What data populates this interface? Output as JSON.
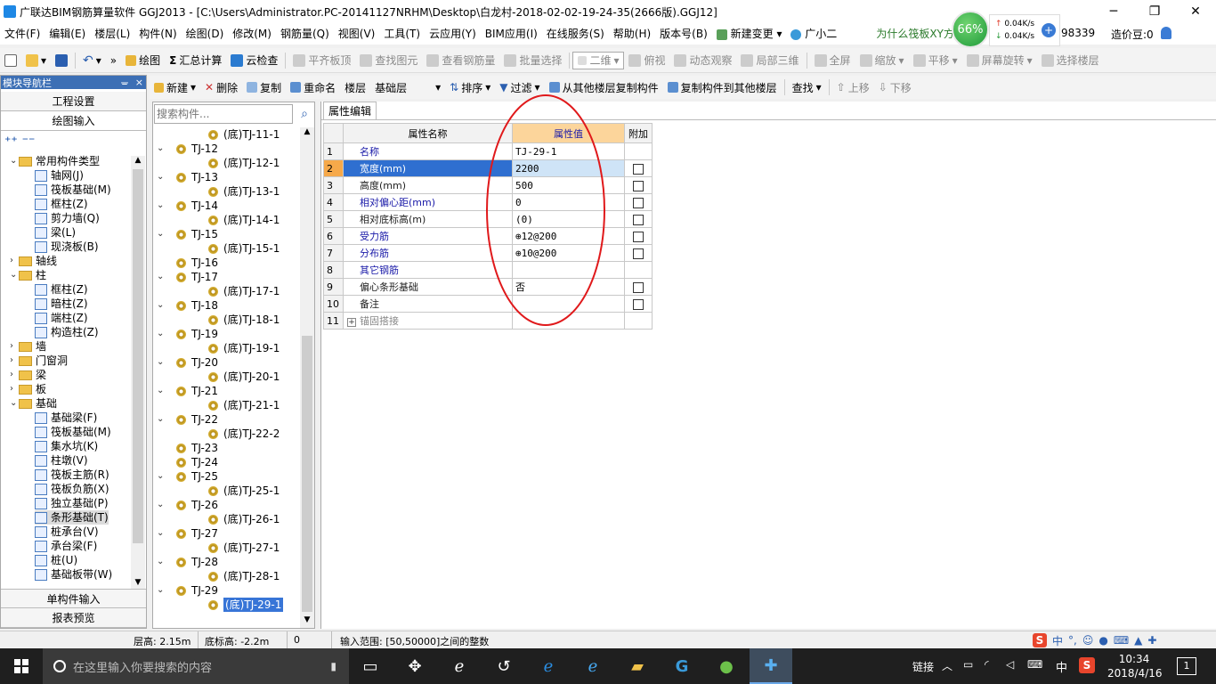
{
  "window": {
    "title": "广联达BIM钢筋算量软件 GGJ2013 - [C:\\Users\\Administrator.PC-20141127NRHM\\Desktop\\白龙村-2018-02-02-19-24-35(2666版).GGJ12]",
    "minimize": "─",
    "maximize": "❐",
    "close": "✕"
  },
  "menu": [
    "文件(F)",
    "编辑(E)",
    "楼层(L)",
    "构件(N)",
    "绘图(D)",
    "修改(M)",
    "钢筋量(Q)",
    "视图(V)",
    "工具(T)",
    "云应用(Y)",
    "BIM应用(I)",
    "在线服务(S)",
    "帮助(H)",
    "版本号(B)"
  ],
  "menu_right": {
    "new_change": "新建变更",
    "assistant": "广小二",
    "marquee": "为什么筏板XY方向布",
    "score": "98339",
    "price_bean": "造价豆:0"
  },
  "net_widget": {
    "percent": "66%",
    "up": "0.04K/s",
    "down": "0.04K/s"
  },
  "toolbar1": [
    {
      "label": "绘图",
      "disabled": false
    },
    {
      "label": "汇总计算",
      "disabled": false
    },
    {
      "label": "云检查",
      "disabled": false
    },
    {
      "label": "平齐板顶",
      "disabled": true
    },
    {
      "label": "查找图元",
      "disabled": true
    },
    {
      "label": "查看钢筋量",
      "disabled": true
    },
    {
      "label": "批量选择",
      "disabled": true
    }
  ],
  "view_select": "二维",
  "toolbar1_right": [
    "俯视",
    "动态观察",
    "局部三维",
    "全屏",
    "缩放",
    "平移",
    "屏幕旋转",
    "选择楼层"
  ],
  "toolbar2": {
    "new": "新建",
    "delete": "删除",
    "copy": "复制",
    "rename": "重命名",
    "floor_label": "楼层",
    "floor_value": "基础层",
    "sort": "排序",
    "filter": "过滤",
    "copy_from": "从其他楼层复制构件",
    "copy_to": "复制构件到其他楼层",
    "find": "查找",
    "up": "上移",
    "down": "下移"
  },
  "nav": {
    "header": "模块导航栏",
    "pin": "ᚚ",
    "close": "×",
    "project_settings": "工程设置",
    "draw_input": "绘图输入",
    "single_input": "单构件输入",
    "report": "报表预览"
  },
  "nav_tree": [
    {
      "type": "folder",
      "label": "常用构件类型",
      "level": 0,
      "open": true
    },
    {
      "type": "item",
      "label": "轴网(J)",
      "level": 1
    },
    {
      "type": "item",
      "label": "筏板基础(M)",
      "level": 1
    },
    {
      "type": "item",
      "label": "框柱(Z)",
      "level": 1
    },
    {
      "type": "item",
      "label": "剪力墙(Q)",
      "level": 1
    },
    {
      "type": "item",
      "label": "梁(L)",
      "level": 1
    },
    {
      "type": "item",
      "label": "现浇板(B)",
      "level": 1
    },
    {
      "type": "folder",
      "label": "轴线",
      "level": 0,
      "open": false
    },
    {
      "type": "folder",
      "label": "柱",
      "level": 0,
      "open": true
    },
    {
      "type": "item",
      "label": "框柱(Z)",
      "level": 1
    },
    {
      "type": "item",
      "label": "暗柱(Z)",
      "level": 1
    },
    {
      "type": "item",
      "label": "端柱(Z)",
      "level": 1
    },
    {
      "type": "item",
      "label": "构造柱(Z)",
      "level": 1
    },
    {
      "type": "folder",
      "label": "墙",
      "level": 0,
      "open": false
    },
    {
      "type": "folder",
      "label": "门窗洞",
      "level": 0,
      "open": false
    },
    {
      "type": "folder",
      "label": "梁",
      "level": 0,
      "open": false
    },
    {
      "type": "folder",
      "label": "板",
      "level": 0,
      "open": false
    },
    {
      "type": "folder",
      "label": "基础",
      "level": 0,
      "open": true
    },
    {
      "type": "item",
      "label": "基础梁(F)",
      "level": 1
    },
    {
      "type": "item",
      "label": "筏板基础(M)",
      "level": 1
    },
    {
      "type": "item",
      "label": "集水坑(K)",
      "level": 1
    },
    {
      "type": "item",
      "label": "柱墩(V)",
      "level": 1
    },
    {
      "type": "item",
      "label": "筏板主筋(R)",
      "level": 1
    },
    {
      "type": "item",
      "label": "筏板负筋(X)",
      "level": 1
    },
    {
      "type": "item",
      "label": "独立基础(P)",
      "level": 1
    },
    {
      "type": "item",
      "label": "条形基础(T)",
      "level": 1,
      "selected": true
    },
    {
      "type": "item",
      "label": "桩承台(V)",
      "level": 1
    },
    {
      "type": "item",
      "label": "承台梁(F)",
      "level": 1
    },
    {
      "type": "item",
      "label": "桩(U)",
      "level": 1
    },
    {
      "type": "item",
      "label": "基础板带(W)",
      "level": 1
    }
  ],
  "search": {
    "placeholder": "搜索构件..."
  },
  "comp_tree": [
    {
      "label": "(底)TJ-11-1",
      "child": true
    },
    {
      "label": "TJ-12",
      "child": false,
      "open": true
    },
    {
      "label": "(底)TJ-12-1",
      "child": true
    },
    {
      "label": "TJ-13",
      "child": false,
      "open": true
    },
    {
      "label": "(底)TJ-13-1",
      "child": true
    },
    {
      "label": "TJ-14",
      "child": false,
      "open": true
    },
    {
      "label": "(底)TJ-14-1",
      "child": true
    },
    {
      "label": "TJ-15",
      "child": false,
      "open": true
    },
    {
      "label": "(底)TJ-15-1",
      "child": true
    },
    {
      "label": "TJ-16",
      "child": false,
      "open": false
    },
    {
      "label": "TJ-17",
      "child": false,
      "open": true
    },
    {
      "label": "(底)TJ-17-1",
      "child": true
    },
    {
      "label": "TJ-18",
      "child": false,
      "open": true
    },
    {
      "label": "(底)TJ-18-1",
      "child": true
    },
    {
      "label": "TJ-19",
      "child": false,
      "open": true
    },
    {
      "label": "(底)TJ-19-1",
      "child": true
    },
    {
      "label": "TJ-20",
      "child": false,
      "open": true
    },
    {
      "label": "(底)TJ-20-1",
      "child": true
    },
    {
      "label": "TJ-21",
      "child": false,
      "open": true
    },
    {
      "label": "(底)TJ-21-1",
      "child": true
    },
    {
      "label": "TJ-22",
      "child": false,
      "open": true
    },
    {
      "label": "(底)TJ-22-2",
      "child": true
    },
    {
      "label": "TJ-23",
      "child": false,
      "open": false
    },
    {
      "label": "TJ-24",
      "child": false,
      "open": false
    },
    {
      "label": "TJ-25",
      "child": false,
      "open": true
    },
    {
      "label": "(底)TJ-25-1",
      "child": true
    },
    {
      "label": "TJ-26",
      "child": false,
      "open": true
    },
    {
      "label": "(底)TJ-26-1",
      "child": true
    },
    {
      "label": "TJ-27",
      "child": false,
      "open": true
    },
    {
      "label": "(底)TJ-27-1",
      "child": true
    },
    {
      "label": "TJ-28",
      "child": false,
      "open": true
    },
    {
      "label": "(底)TJ-28-1",
      "child": true
    },
    {
      "label": "TJ-29",
      "child": false,
      "open": true
    },
    {
      "label": "(底)TJ-29-1",
      "child": true,
      "selected": true
    }
  ],
  "prop_tab": "属性编辑",
  "prop_headers": {
    "name": "属性名称",
    "value": "属性值",
    "extra": "附加"
  },
  "props": [
    {
      "n": "1",
      "name": "名称",
      "value": "TJ-29-1",
      "check": false,
      "blue": true
    },
    {
      "n": "2",
      "name": "宽度(mm)",
      "value": "2200",
      "check": true,
      "blue": true,
      "selected": true
    },
    {
      "n": "3",
      "name": "高度(mm)",
      "value": "500",
      "check": true,
      "blue": false
    },
    {
      "n": "4",
      "name": "相对偏心距(mm)",
      "value": "0",
      "check": true,
      "blue": true
    },
    {
      "n": "5",
      "name": "相对底标高(m)",
      "value": "(0)",
      "check": true,
      "blue": false
    },
    {
      "n": "6",
      "name": "受力筋",
      "value": "⊕12@200",
      "check": true,
      "blue": true
    },
    {
      "n": "7",
      "name": "分布筋",
      "value": "⊕10@200",
      "check": true,
      "blue": true
    },
    {
      "n": "8",
      "name": "其它钢筋",
      "value": "",
      "check": false,
      "blue": true
    },
    {
      "n": "9",
      "name": "偏心条形基础",
      "value": "否",
      "check": true,
      "blue": false
    },
    {
      "n": "10",
      "name": "备注",
      "value": "",
      "check": true,
      "blue": false
    },
    {
      "n": "11",
      "name": "锚固搭接",
      "value": "",
      "check": false,
      "blue": false,
      "expand": "+"
    }
  ],
  "status": {
    "floor_height": "层高: 2.15m",
    "bottom_elev": "底标高: -2.2m",
    "zero": "0",
    "hint": "输入范围: [50,50000]之间的整数"
  },
  "taskbar": {
    "search": "在这里输入你要搜索的内容",
    "link": "链接",
    "ime": "中",
    "time": "10:34",
    "date": "2018/4/16",
    "notif": "1"
  },
  "colors": {
    "accent": "#3c6fb5",
    "selected_row": "#cfe4f7",
    "selected_tree": "#3875d7",
    "annot": "#e0191b",
    "header_orange": "#fcd59b"
  }
}
